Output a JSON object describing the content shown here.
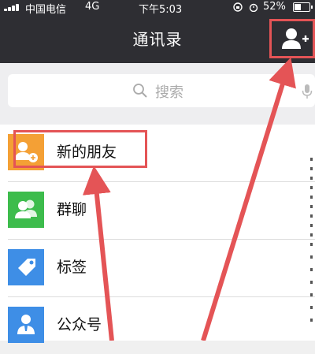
{
  "status_bar": {
    "carrier": "中国电信",
    "network": "4G",
    "time": "下午5:03",
    "battery": "52%",
    "battery_level": 0.52
  },
  "nav": {
    "title": "通讯录",
    "add_contact_icon": "add-person-icon"
  },
  "search": {
    "placeholder": "搜索",
    "icon": "search-icon",
    "mic_icon": "microphone-icon"
  },
  "list": {
    "items": [
      {
        "label": "新的朋友",
        "icon": "add-friend-icon",
        "color": "#f4a035"
      },
      {
        "label": "群聊",
        "icon": "group-chat-icon",
        "color": "#3dbc4c"
      },
      {
        "label": "标签",
        "icon": "tag-icon",
        "color": "#3e8ee6"
      },
      {
        "label": "公众号",
        "icon": "official-account-icon",
        "color": "#3e8ee6"
      }
    ]
  },
  "colors": {
    "nav_bg": "#2e2e33",
    "annotation": "#e45456"
  }
}
